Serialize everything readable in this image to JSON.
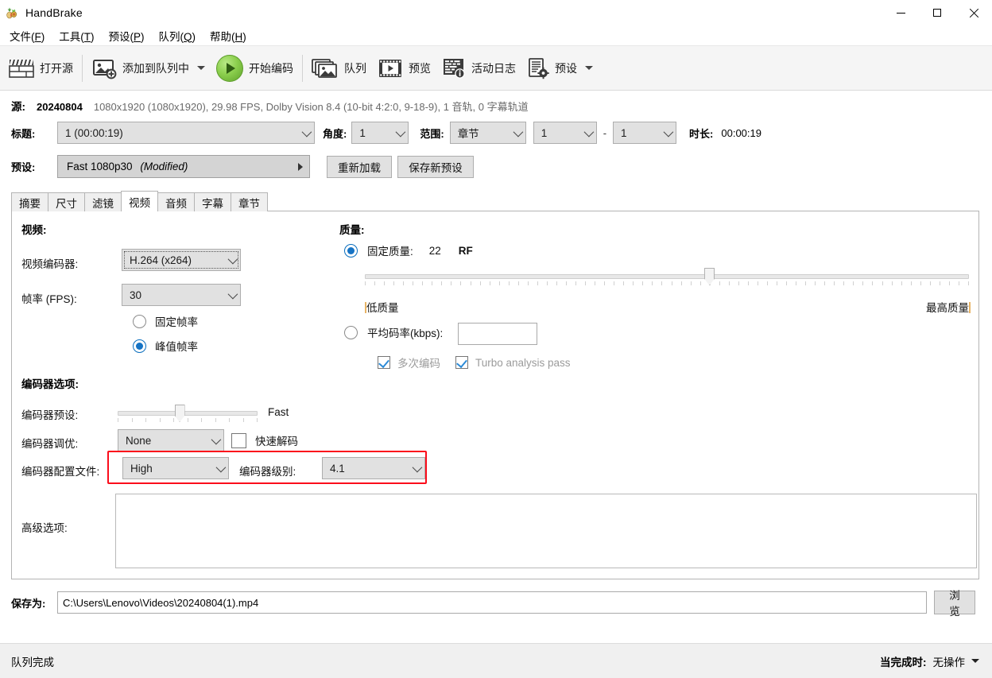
{
  "window": {
    "title": "HandBrake",
    "app_icon": "handbrake-pineapple-icon",
    "controls": {
      "minimize": "minimize-icon",
      "maximize": "maximize-icon",
      "close": "close-icon"
    }
  },
  "menubar": [
    {
      "name": "file",
      "label": "文件(F)",
      "mnemonic": "F",
      "pre": "文件(",
      "post": ")"
    },
    {
      "name": "tools",
      "label": "工具(T)",
      "mnemonic": "T",
      "pre": "工具(",
      "post": ")"
    },
    {
      "name": "presets",
      "label": "预设(P)",
      "mnemonic": "P",
      "pre": "预设(",
      "post": ")"
    },
    {
      "name": "queue",
      "label": "队列(Q)",
      "mnemonic": "Q",
      "pre": "队列(",
      "post": ")"
    },
    {
      "name": "help",
      "label": "帮助(H)",
      "mnemonic": "H",
      "pre": "帮助(",
      "post": ")"
    }
  ],
  "toolbar": {
    "open_source": "打开源",
    "add_to_queue": "添加到队列中",
    "start_encode": "开始编码",
    "queue": "队列",
    "preview": "预览",
    "activity_log": "活动日志",
    "presets": "预设",
    "icons": {
      "open_source": "film-slate-icon",
      "add_to_queue": "add-to-queue-icon",
      "start_encode": "play-icon",
      "queue": "queue-stack-icon",
      "preview": "preview-film-icon",
      "activity_log": "activity-log-icon",
      "presets": "presets-gear-icon"
    }
  },
  "source": {
    "label": "源:",
    "name": "20240804",
    "meta": "1080x1920 (1080x1920), 29.98 FPS, Dolby Vision 8.4 (10-bit 4:2:0, 9-18-9), 1 音轨, 0 字幕轨道"
  },
  "title_row": {
    "title_label": "标题:",
    "title_value": "1 (00:00:19)",
    "angle_label": "角度:",
    "angle_value": "1",
    "range_label": "范围:",
    "range_value": "章节",
    "chapter_start": "1",
    "chapter_sep": "-",
    "chapter_end": "1",
    "duration_label": "时长:",
    "duration_value": "00:00:19"
  },
  "preset_row": {
    "label": "预设:",
    "value": "Fast 1080p30",
    "modified": "(Modified)",
    "reload_button": "重新加载",
    "save_new_button": "保存新预设"
  },
  "tabs": [
    {
      "name": "summary",
      "label": "摘要",
      "active": false
    },
    {
      "name": "dimensions",
      "label": "尺寸",
      "active": false
    },
    {
      "name": "filters",
      "label": "滤镜",
      "active": false
    },
    {
      "name": "video",
      "label": "视频",
      "active": true
    },
    {
      "name": "audio",
      "label": "音频",
      "active": false
    },
    {
      "name": "subtitles",
      "label": "字幕",
      "active": false
    },
    {
      "name": "chapters",
      "label": "章节",
      "active": false
    }
  ],
  "video_tab": {
    "video_section_title": "视频:",
    "encoder_label": "视频编码器:",
    "encoder_value": "H.264 (x264)",
    "framerate_label": "帧率 (FPS):",
    "framerate_value": "30",
    "constant_framerate_label": "固定帧率",
    "constant_framerate_selected": false,
    "peak_framerate_label": "峰值帧率",
    "peak_framerate_selected": true,
    "quality_section_title": "质量:",
    "constant_quality_label": "固定质量:",
    "constant_quality_selected": true,
    "rf_value": "22",
    "rf_unit": "RF",
    "quality_slider_percent": 57,
    "quality_low_label": "低质量",
    "quality_high_label": "最高质量",
    "avg_bitrate_label": "平均码率(kbps):",
    "avg_bitrate_selected": false,
    "avg_bitrate_value": "",
    "multipass_label": "多次编码",
    "multipass_checked": true,
    "multipass_enabled": false,
    "turbo_label": "Turbo analysis pass",
    "turbo_checked": true,
    "turbo_enabled": false,
    "encoder_options_title": "编码器选项:",
    "encoder_preset_label": "编码器预设:",
    "encoder_preset_value": "Fast",
    "encoder_preset_percent": 44,
    "encoder_tune_label": "编码器调优:",
    "encoder_tune_value": "None",
    "fast_decode_label": "快速解码",
    "fast_decode_checked": false,
    "encoder_profile_label": "编码器配置文件:",
    "encoder_profile_value": "High",
    "encoder_level_label": "编码器级别:",
    "encoder_level_value": "4.1",
    "advanced_options_label": "高级选项:",
    "advanced_options_value": "",
    "highlight_color": "#fb0d1b"
  },
  "save_row": {
    "label": "保存为:",
    "path": "C:\\Users\\Lenovo\\Videos\\20240804(1).mp4",
    "browse_button": "浏览"
  },
  "statusbar": {
    "status": "队列完成",
    "when_done_label": "当完成时:",
    "when_done_value": "无操作"
  }
}
